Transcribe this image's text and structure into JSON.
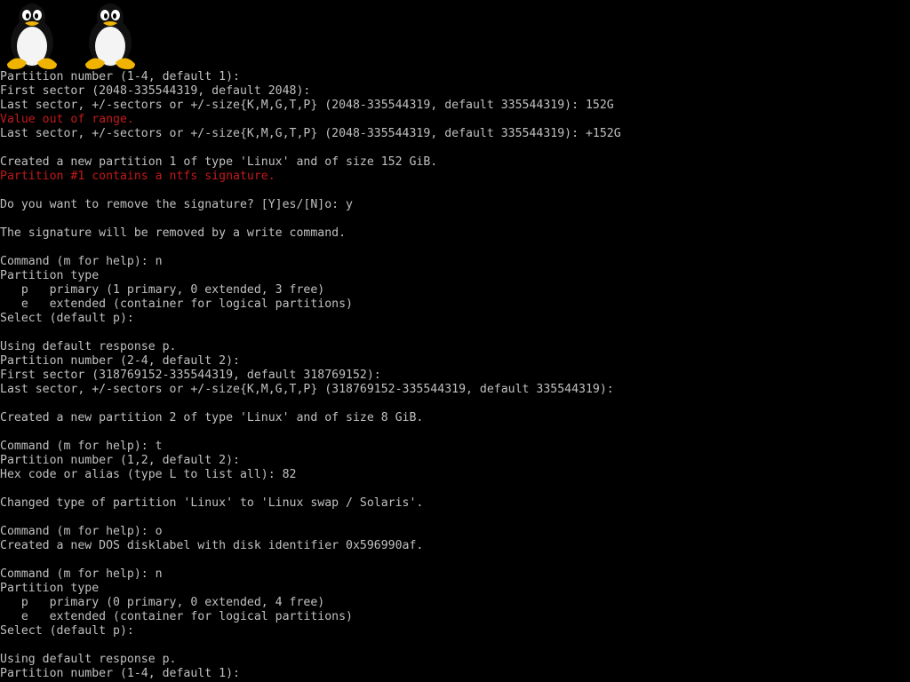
{
  "logos": [
    "tux-penguin-icon",
    "tux-penguin-icon"
  ],
  "colors": {
    "background": "#000000",
    "text": "#c0c0c0",
    "error": "#c41a1a"
  },
  "lines": [
    {
      "text": "Partition number (1-4, default 1):",
      "type": "normal"
    },
    {
      "text": "First sector (2048-335544319, default 2048):",
      "type": "normal"
    },
    {
      "text": "Last sector, +/-sectors or +/-size{K,M,G,T,P} (2048-335544319, default 335544319): 152G",
      "type": "normal"
    },
    {
      "text": "Value out of range.",
      "type": "error"
    },
    {
      "text": "Last sector, +/-sectors or +/-size{K,M,G,T,P} (2048-335544319, default 335544319): +152G",
      "type": "normal"
    },
    {
      "text": "",
      "type": "normal"
    },
    {
      "text": "Created a new partition 1 of type 'Linux' and of size 152 GiB.",
      "type": "normal"
    },
    {
      "text": "Partition #1 contains a ntfs signature.",
      "type": "error"
    },
    {
      "text": "",
      "type": "normal"
    },
    {
      "text": "Do you want to remove the signature? [Y]es/[N]o: y",
      "type": "normal"
    },
    {
      "text": "",
      "type": "normal"
    },
    {
      "text": "The signature will be removed by a write command.",
      "type": "normal"
    },
    {
      "text": "",
      "type": "normal"
    },
    {
      "text": "Command (m for help): n",
      "type": "normal"
    },
    {
      "text": "Partition type",
      "type": "normal"
    },
    {
      "text": "   p   primary (1 primary, 0 extended, 3 free)",
      "type": "normal"
    },
    {
      "text": "   e   extended (container for logical partitions)",
      "type": "normal"
    },
    {
      "text": "Select (default p):",
      "type": "normal"
    },
    {
      "text": "",
      "type": "normal"
    },
    {
      "text": "Using default response p.",
      "type": "normal"
    },
    {
      "text": "Partition number (2-4, default 2):",
      "type": "normal"
    },
    {
      "text": "First sector (318769152-335544319, default 318769152):",
      "type": "normal"
    },
    {
      "text": "Last sector, +/-sectors or +/-size{K,M,G,T,P} (318769152-335544319, default 335544319):",
      "type": "normal"
    },
    {
      "text": "",
      "type": "normal"
    },
    {
      "text": "Created a new partition 2 of type 'Linux' and of size 8 GiB.",
      "type": "normal"
    },
    {
      "text": "",
      "type": "normal"
    },
    {
      "text": "Command (m for help): t",
      "type": "normal"
    },
    {
      "text": "Partition number (1,2, default 2):",
      "type": "normal"
    },
    {
      "text": "Hex code or alias (type L to list all): 82",
      "type": "normal"
    },
    {
      "text": "",
      "type": "normal"
    },
    {
      "text": "Changed type of partition 'Linux' to 'Linux swap / Solaris'.",
      "type": "normal"
    },
    {
      "text": "",
      "type": "normal"
    },
    {
      "text": "Command (m for help): o",
      "type": "normal"
    },
    {
      "text": "Created a new DOS disklabel with disk identifier 0x596990af.",
      "type": "normal"
    },
    {
      "text": "",
      "type": "normal"
    },
    {
      "text": "Command (m for help): n",
      "type": "normal"
    },
    {
      "text": "Partition type",
      "type": "normal"
    },
    {
      "text": "   p   primary (0 primary, 0 extended, 4 free)",
      "type": "normal"
    },
    {
      "text": "   e   extended (container for logical partitions)",
      "type": "normal"
    },
    {
      "text": "Select (default p):",
      "type": "normal"
    },
    {
      "text": "",
      "type": "normal"
    },
    {
      "text": "Using default response p.",
      "type": "normal"
    },
    {
      "text": "Partition number (1-4, default 1):",
      "type": "normal"
    }
  ]
}
